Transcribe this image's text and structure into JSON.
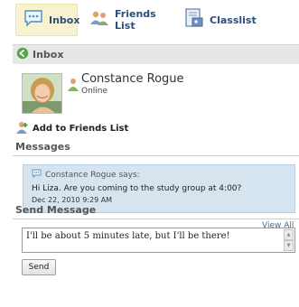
{
  "tabs": {
    "inbox": "Inbox",
    "friends": "Friends List",
    "classlist": "Classlist"
  },
  "inbox_header": {
    "title": "Inbox"
  },
  "contact": {
    "name": "Constance Rogue",
    "status": "Online"
  },
  "actions": {
    "add_friend": "Add to Friends List"
  },
  "messages": {
    "title": "Messages",
    "items": [
      {
        "sender": "Constance Rogue says:",
        "text": "Hi Liza. Are you coming to the study group at 4:00?",
        "date": "Dec 22, 2010 9:29 AM"
      }
    ],
    "view_all": "View All"
  },
  "send": {
    "title": "Send Message",
    "input_value": "I'll be about 5 minutes late, but I'll be there!",
    "button": "Send"
  },
  "colors": {
    "active_tab_bg": "#f7f2cf",
    "message_bg": "#d6e4f0",
    "link": "#3a6ea5",
    "header_bg": "#e7e7e7"
  },
  "icons": {
    "inbox": "chat-bubble-icon",
    "friends": "friends-icon",
    "classlist": "classlist-icon",
    "back": "back-arrow-icon",
    "status": "online-user-icon",
    "add_friend": "add-friend-icon",
    "message": "chat-bubble-icon"
  }
}
